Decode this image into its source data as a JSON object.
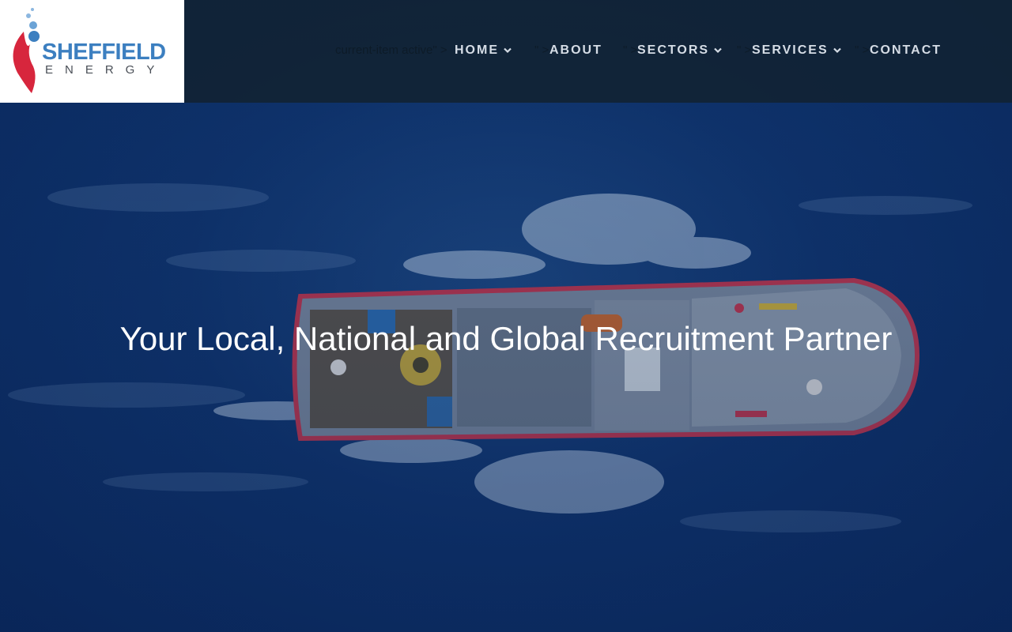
{
  "site": {
    "logo_word": "SHEFFIELD",
    "logo_sub": "ENERGY",
    "brand_blue": "#3c7fc0",
    "brand_red": "#d7263d"
  },
  "nav": {
    "artifacts": {
      "home_prefix": "current-item active\" >",
      "about_prefix": "\" >",
      "sectors_prefix": "\" >",
      "services_prefix": "\" >",
      "contact_prefix": "\" >"
    },
    "items": [
      {
        "label": "HOME",
        "has_dropdown": true,
        "icon": "chevron-down-icon"
      },
      {
        "label": "ABOUT",
        "has_dropdown": false
      },
      {
        "label": "SECTORS",
        "has_dropdown": true,
        "icon": "chevron-down-icon"
      },
      {
        "label": "SERVICES",
        "has_dropdown": true,
        "icon": "chevron-down-icon"
      },
      {
        "label": "CONTACT",
        "has_dropdown": false
      }
    ]
  },
  "hero": {
    "title": "Your Local, National and Global Recruitment Partner",
    "image": "aerial-ship-icon"
  }
}
